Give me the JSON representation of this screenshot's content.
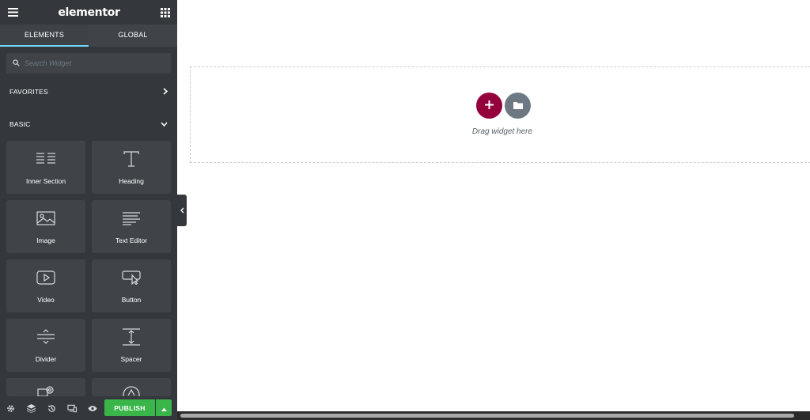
{
  "header": {
    "brand": "elementor"
  },
  "tabs": [
    {
      "label": "ELEMENTS",
      "active": true
    },
    {
      "label": "GLOBAL",
      "active": false
    }
  ],
  "search": {
    "placeholder": "Search Widget"
  },
  "categories": {
    "favorites": {
      "label": "FAVORITES",
      "icon": "chevron-right-icon"
    },
    "basic": {
      "label": "BASIC",
      "icon": "chevron-down-icon"
    }
  },
  "widgets": [
    {
      "label": "Inner Section",
      "icon": "inner-section-icon"
    },
    {
      "label": "Heading",
      "icon": "heading-icon"
    },
    {
      "label": "Image",
      "icon": "image-icon"
    },
    {
      "label": "Text Editor",
      "icon": "text-editor-icon"
    },
    {
      "label": "Video",
      "icon": "video-icon"
    },
    {
      "label": "Button",
      "icon": "button-icon"
    },
    {
      "label": "Divider",
      "icon": "divider-icon"
    },
    {
      "label": "Spacer",
      "icon": "spacer-icon"
    }
  ],
  "footer": {
    "icons": [
      "settings-icon",
      "navigator-icon",
      "history-icon",
      "responsive-icon",
      "preview-icon"
    ],
    "publish_label": "PUBLISH"
  },
  "canvas": {
    "drag_text": "Drag widget here"
  },
  "colors": {
    "panel": "#34383c",
    "widget": "#404449",
    "tab_accent": "#71d7f7",
    "publish": "#39b54a",
    "add_button": "#93003c",
    "template_button": "#6d7882"
  }
}
